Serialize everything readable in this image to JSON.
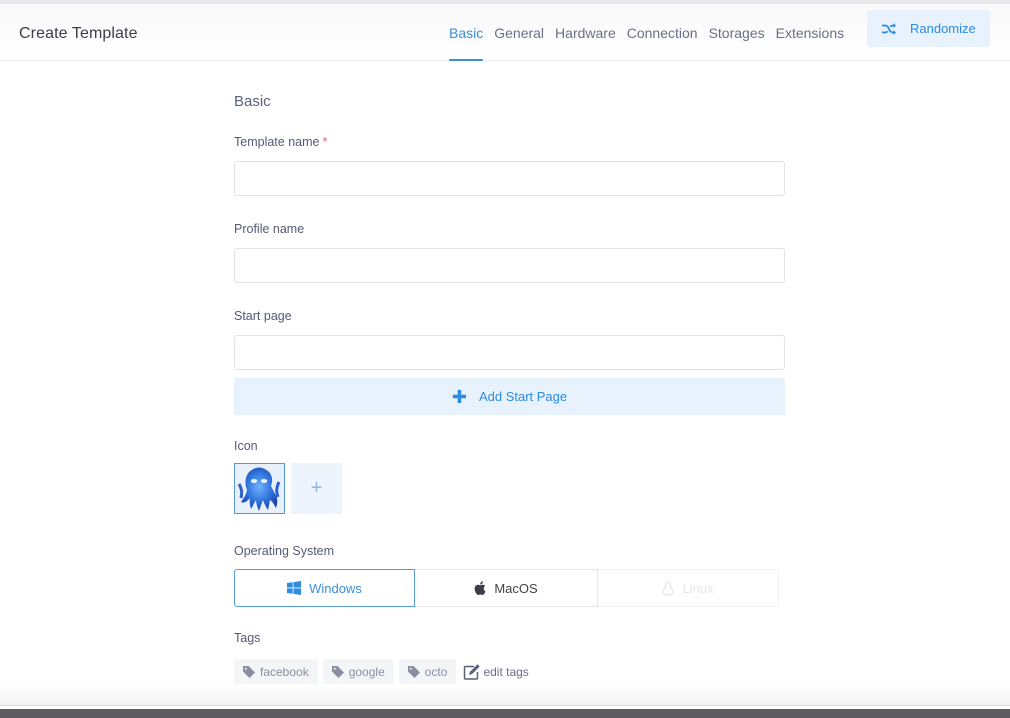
{
  "header": {
    "title": "Create Template",
    "tabs": [
      {
        "label": "Basic",
        "active": true
      },
      {
        "label": "General",
        "active": false
      },
      {
        "label": "Hardware",
        "active": false
      },
      {
        "label": "Connection",
        "active": false
      },
      {
        "label": "Storages",
        "active": false
      },
      {
        "label": "Extensions",
        "active": false
      }
    ],
    "randomize_label": "Randomize",
    "randomize_icon": "shuffle-icon"
  },
  "form": {
    "section_title": "Basic",
    "template_name": {
      "label": "Template name",
      "required_mark": "*",
      "value": "",
      "placeholder": ""
    },
    "profile_name": {
      "label": "Profile name",
      "value": "",
      "placeholder": ""
    },
    "start_page": {
      "label": "Start page",
      "value": "",
      "placeholder": ""
    },
    "add_start_page_label": "Add Start Page",
    "add_start_page_icon": "plus-icon",
    "icon_section": {
      "label": "Icon",
      "selected_icon": "octopus-avatar",
      "add_label": "+"
    },
    "operating_system": {
      "label": "Operating System",
      "options": [
        {
          "label": "Windows",
          "icon": "windows-icon",
          "selected": true,
          "disabled": false
        },
        {
          "label": "MacOS",
          "icon": "apple-icon",
          "selected": false,
          "disabled": false
        },
        {
          "label": "Linux",
          "icon": "linux-icon",
          "selected": false,
          "disabled": true
        }
      ]
    },
    "tags": {
      "label": "Tags",
      "items": [
        "facebook",
        "google",
        "octo"
      ],
      "edit_label": "edit tags"
    }
  },
  "colors": {
    "accent": "#3a8fdb",
    "accent_bg": "#e7f2fd",
    "required": "#e35d6a",
    "text_label": "#555a75"
  }
}
